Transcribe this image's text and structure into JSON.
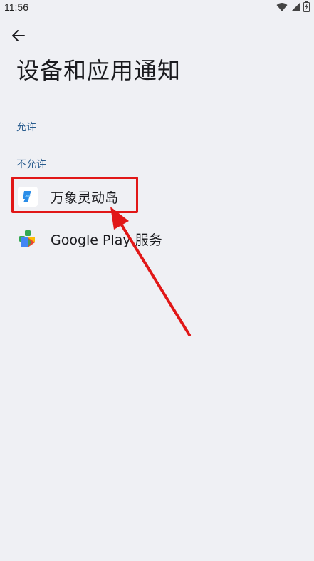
{
  "status_bar": {
    "time": "11:56",
    "icons": [
      "wifi-icon",
      "signal-icon",
      "battery-icon"
    ]
  },
  "header": {
    "back_icon": "back-arrow-icon",
    "title": "设备和应用通知"
  },
  "sections": {
    "allowed": {
      "label": "允许",
      "items": []
    },
    "denied": {
      "label": "不允许",
      "items": [
        {
          "label": "万象灵动岛",
          "icon": "wanxiang-app-icon"
        },
        {
          "label": "Google Play 服务",
          "icon": "google-play-services-icon"
        }
      ]
    }
  },
  "annotation": {
    "highlight_color": "#e11717",
    "target": "万象灵动岛"
  },
  "colors": {
    "background": "#eff0f4",
    "section_header": "#2a5d8f",
    "text": "#1b1b1f"
  }
}
